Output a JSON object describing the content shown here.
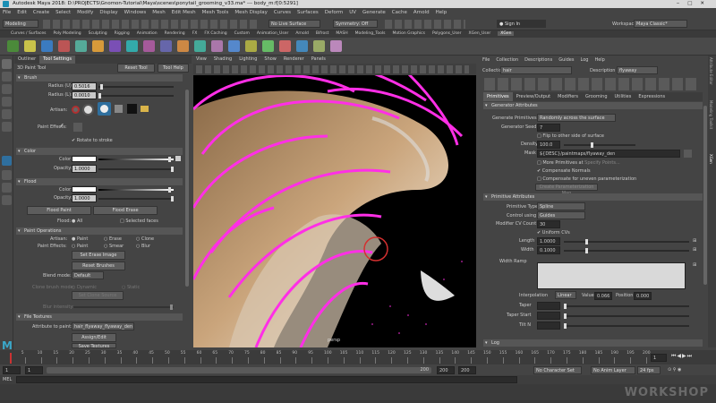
{
  "window": {
    "title": "Autodesk Maya 2018: D:\\PROJECTS\\Gnomon-Tutorial\\Maya\\scenes\\ponytail_grooming_v33.ma* --- body_m:f[0:5291]"
  },
  "menu": [
    "File",
    "Edit",
    "Create",
    "Select",
    "Modify",
    "Display",
    "Windows",
    "Mesh",
    "Edit Mesh",
    "Mesh Tools",
    "Mesh Display",
    "Curves",
    "Surfaces",
    "Deform",
    "UV",
    "Generate",
    "Cache",
    "Arnold",
    "Help"
  ],
  "status": {
    "mode": "Modeling",
    "live_surface": "No Live Surface",
    "symmetry": "Symmetry: Off",
    "sign_in": "Sign In",
    "workspace_label": "Workspace :",
    "workspace": "Maya Classic*"
  },
  "shelf_tabs": [
    "Curves / Surfaces",
    "Poly Modeling",
    "Sculpting",
    "Rigging",
    "Animation",
    "Rendering",
    "FX",
    "FX Caching",
    "Custom",
    "Animation_User",
    "Arnold",
    "Bifrost",
    "MASH",
    "Modeling_Tools",
    "Motion Graphics",
    "Polygons_User",
    "XGen_User",
    "XGen"
  ],
  "shelf_active": "XGen",
  "left_panel": {
    "tabs": [
      "Outliner",
      "Tool Settings"
    ],
    "tool_name": "3D Paint Tool",
    "reset_tool": "Reset Tool",
    "tool_help": "Tool Help",
    "brush": {
      "title": "Brush",
      "radius_u_label": "Radius (U):",
      "radius_u": "0.5016",
      "radius_l_label": "Radius (L):",
      "radius_l": "0.0010",
      "artisan": "Artisan:",
      "paint_effects": "Paint Effects:",
      "rotate": "Rotate to stroke"
    },
    "color": {
      "title": "Color",
      "color_label": "Color:",
      "opacity_label": "Opacity:",
      "opacity": "1.0000"
    },
    "flood": {
      "title": "Flood",
      "color_label": "Color:",
      "opacity_label": "Opacity:",
      "opacity": "1.0000",
      "flood_paint": "Flood Paint",
      "flood_erase": "Flood Erase",
      "flood_label": "Flood:",
      "all": "All",
      "selected_faces": "Selected faces"
    },
    "paint_ops": {
      "title": "Paint Operations",
      "artisan": "Artisan:",
      "paint": "Paint",
      "erase": "Erase",
      "clone": "Clone",
      "paint_effects": "Paint Effects:",
      "smear": "Smear",
      "blur": "Blur",
      "set_erase": "Set Erase Image",
      "reset_brushes": "Reset Brushes",
      "blend_mode": "Blend mode:",
      "blend_value": "Default",
      "clone_brush": "Clone brush mode:",
      "dynamic": "Dynamic",
      "static": "Static",
      "set_clone": "Set Clone Source",
      "blur_intensity": "Blur intensity:"
    },
    "file_textures": {
      "title": "File Textures",
      "attribute": "Attribute to paint:",
      "attribute_value": "hair_flyaway_flyaway_den",
      "assign": "Assign/Edit Textures",
      "save": "Save Textures"
    }
  },
  "viewport": {
    "menu": [
      "View",
      "Shading",
      "Lighting",
      "Show",
      "Renderer",
      "Panels"
    ],
    "camera": "persp"
  },
  "xgen": {
    "menu": [
      "File",
      "Collection",
      "Descriptions",
      "Guides",
      "Log",
      "Help"
    ],
    "collection_label": "Collection",
    "collection": "hair",
    "description_label": "Description",
    "description": "flyaway",
    "tabs": [
      "Primitives",
      "Preview/Output",
      "Modifiers",
      "Grooming",
      "Utilities",
      "Expressions"
    ],
    "generator": {
      "title": "Generator Attributes",
      "generate_label": "Generate Primitives",
      "generate": "Randomly across the surface",
      "seed_label": "Generator Seed",
      "seed": "7",
      "flip": "Flip to other side of surface",
      "density_label": "Density",
      "density": "100.0",
      "mask_label": "Mask",
      "mask": "${DESC}/paintmaps/flyaway_den",
      "more": "More Primitives at",
      "specify": "Specify Points...",
      "compensate": "Compensate Normals",
      "uneven": "Compensate for uneven parameterization",
      "create_map": "Create Parameterization Map"
    },
    "primitive": {
      "title": "Primitive Attributes",
      "type_label": "Primitive Type",
      "type": "Spline",
      "control_label": "Control using",
      "control": "Guides",
      "cv_label": "Modifier CV Count",
      "cv": "30",
      "uniform": "Uniform CVs",
      "length_label": "Length",
      "length": "1.0000",
      "width_label": "Width",
      "width": "0.1000",
      "width_ramp": "Width Ramp",
      "interp_label": "Interpolation",
      "interp": "Linear",
      "value_label": "Value",
      "value": "0.066",
      "position_label": "Position",
      "position": "0.000",
      "taper": "Taper",
      "taper_start": "Taper Start",
      "tilt": "Tilt N"
    },
    "log": "Log",
    "side_tabs": [
      "Attribute Editor",
      "Modeling Toolkit",
      "XGen"
    ]
  },
  "timeline": {
    "ticks": [
      "5",
      "10",
      "15",
      "20",
      "25",
      "30",
      "35",
      "40",
      "45",
      "50",
      "55",
      "60",
      "65",
      "70",
      "75",
      "80",
      "85",
      "90",
      "95",
      "100",
      "105",
      "110",
      "115",
      "120",
      "125",
      "130",
      "135",
      "140",
      "145",
      "150",
      "155",
      "160",
      "165",
      "170",
      "175",
      "180",
      "185",
      "190",
      "195",
      "200"
    ],
    "current": "1"
  },
  "range": {
    "start": "1",
    "start2": "1",
    "end": "200",
    "end2": "200",
    "end3": "200",
    "char_set": "No Character Set",
    "anim_layer": "No Anim Layer",
    "fps": "24 fps"
  },
  "cmdline": {
    "lang": "MEL"
  },
  "watermark": "WORKSHOP"
}
